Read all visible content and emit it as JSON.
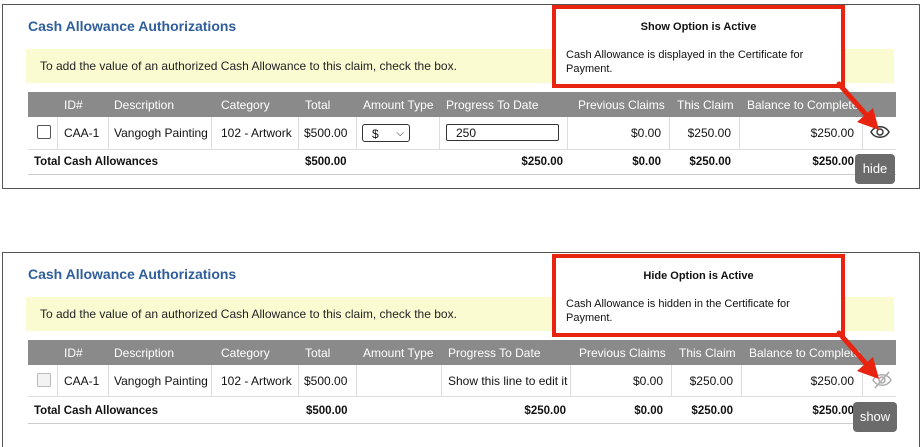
{
  "panels": [
    {
      "title": "Cash Allowance Authorizations",
      "notice": "To add the value of an authorized Cash Allowance to this claim, check the box.",
      "columns": [
        "ID#",
        "Description",
        "Category",
        "Total",
        "Amount Type",
        "Progress To Date",
        "Previous Claims",
        "This Claim",
        "Balance to Complete"
      ],
      "row": {
        "id": "CAA-1",
        "description": "Vangogh Painting",
        "category": "102 - Artwork",
        "total": "$500.00",
        "amount_type": "$",
        "progress": "250",
        "previous": "$0.00",
        "this_claim": "$250.00",
        "balance": "$250.00"
      },
      "totals": {
        "label": "Total Cash Allowances",
        "total": "$500.00",
        "progress": "$250.00",
        "previous": "$0.00",
        "this_claim": "$250.00",
        "balance": "$250.00"
      },
      "toggle_label": "hide",
      "icon": "eye-icon",
      "callout": {
        "title": "Show Option is Active",
        "body": "Cash Allowance is displayed in the Certificate for Payment."
      }
    },
    {
      "title": "Cash Allowance Authorizations",
      "notice": "To add the value of an authorized Cash Allowance to this claim, check the box.",
      "columns": [
        "ID#",
        "Description",
        "Category",
        "Total",
        "Amount Type",
        "Progress To Date",
        "Previous Claims",
        "This Claim",
        "Balance to Complete"
      ],
      "row": {
        "id": "CAA-1",
        "description": "Vangogh Painting",
        "category": "102 - Artwork",
        "total": "$500.00",
        "amount_type": "",
        "progress": "Show this line to edit it",
        "previous": "$0.00",
        "this_claim": "$250.00",
        "balance": "$250.00"
      },
      "totals": {
        "label": "Total Cash Allowances",
        "total": "$500.00",
        "progress": "$250.00",
        "previous": "$0.00",
        "this_claim": "$250.00",
        "balance": "$250.00"
      },
      "toggle_label": "show",
      "icon": "eye-slash-icon",
      "callout": {
        "title": "Hide Option is Active",
        "body": "Cash Allowance is hidden in the Certificate for Payment."
      }
    }
  ],
  "colors": {
    "title": "#2f5e9b",
    "notice_bg": "#fbfbd2",
    "header_bg": "#8a8a8a",
    "callout_border": "#e8230f",
    "button_bg": "#6b6b6b"
  }
}
